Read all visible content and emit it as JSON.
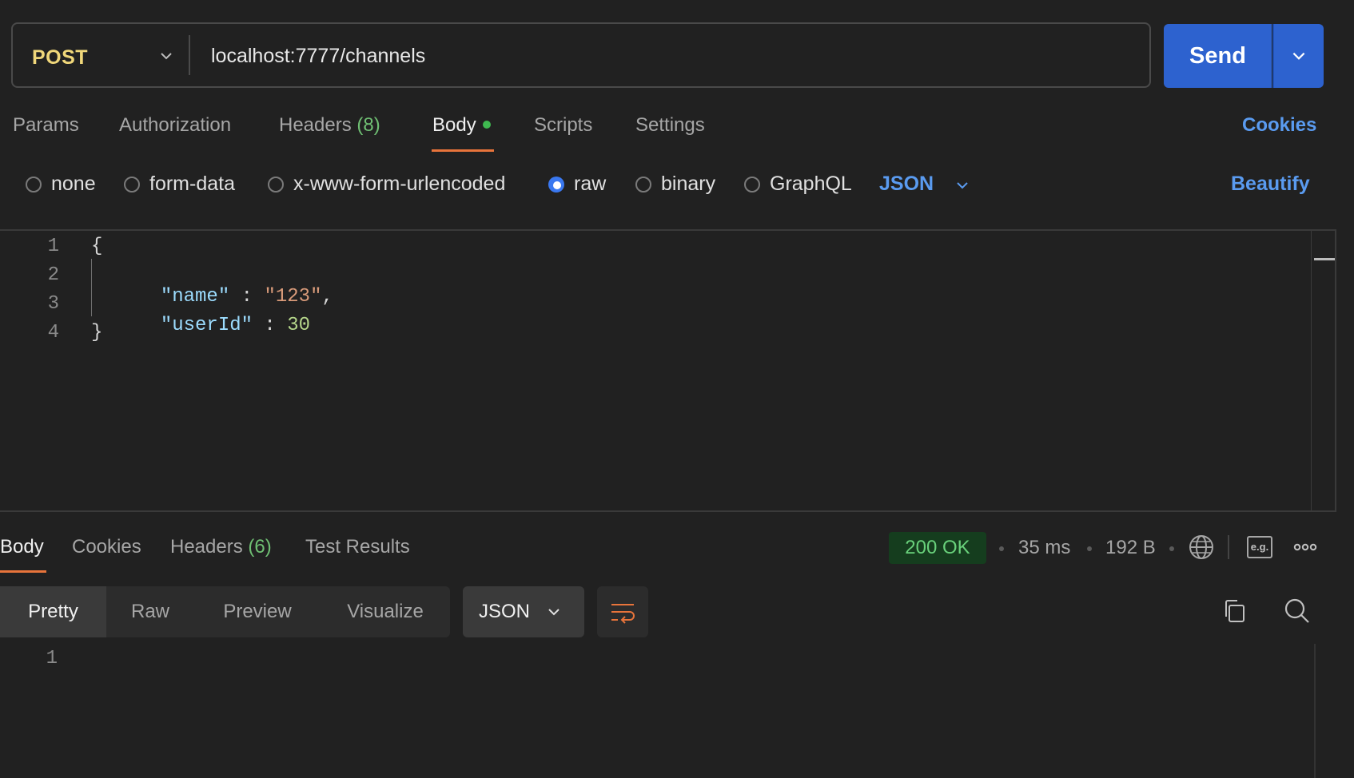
{
  "request": {
    "method": "POST",
    "url": "localhost:7777/channels",
    "send_label": "Send"
  },
  "request_tabs": {
    "params": "Params",
    "authorization": "Authorization",
    "headers": "Headers",
    "headers_count": "(8)",
    "body": "Body",
    "scripts": "Scripts",
    "settings": "Settings",
    "cookies": "Cookies"
  },
  "body_types": {
    "none": "none",
    "form_data": "form-data",
    "urlencoded": "x-www-form-urlencoded",
    "raw": "raw",
    "binary": "binary",
    "graphql": "GraphQL",
    "selected": "raw",
    "language": "JSON",
    "beautify": "Beautify"
  },
  "editor": {
    "line_numbers": [
      "1",
      "2",
      "3",
      "4"
    ],
    "lines": {
      "l1_open": "{",
      "l2_key": "\"name\"",
      "l2_colon": " : ",
      "l2_value": "\"123\"",
      "l2_comma": ",",
      "l3_key": "\"userId\"",
      "l3_colon": " : ",
      "l3_value": "30",
      "l4_close": "}"
    }
  },
  "response": {
    "tabs": {
      "body": "Body",
      "cookies": "Cookies",
      "headers": "Headers",
      "headers_count": "(6)",
      "test_results": "Test Results"
    },
    "status": "200 OK",
    "time": "35 ms",
    "size": "192 B",
    "view_modes": {
      "pretty": "Pretty",
      "raw": "Raw",
      "preview": "Preview",
      "visualize": "Visualize"
    },
    "format": "JSON",
    "example_label": "e.g.",
    "line_numbers": [
      "1"
    ]
  },
  "colors": {
    "background": "#212121",
    "accent_blue": "#2d62cf",
    "link_blue": "#5a9bf0",
    "tab_underline": "#e8743b",
    "method_yellow": "#f0d77a",
    "status_green": "#69d17b"
  },
  "icons": {
    "method_dropdown": "chevron-down-icon",
    "send_dropdown": "chevron-down-icon",
    "network": "globe-icon",
    "example": "example-icon",
    "more": "more-horizontal-icon",
    "wrap": "wrap-lines-icon",
    "copy": "copy-icon",
    "search": "search-icon"
  }
}
